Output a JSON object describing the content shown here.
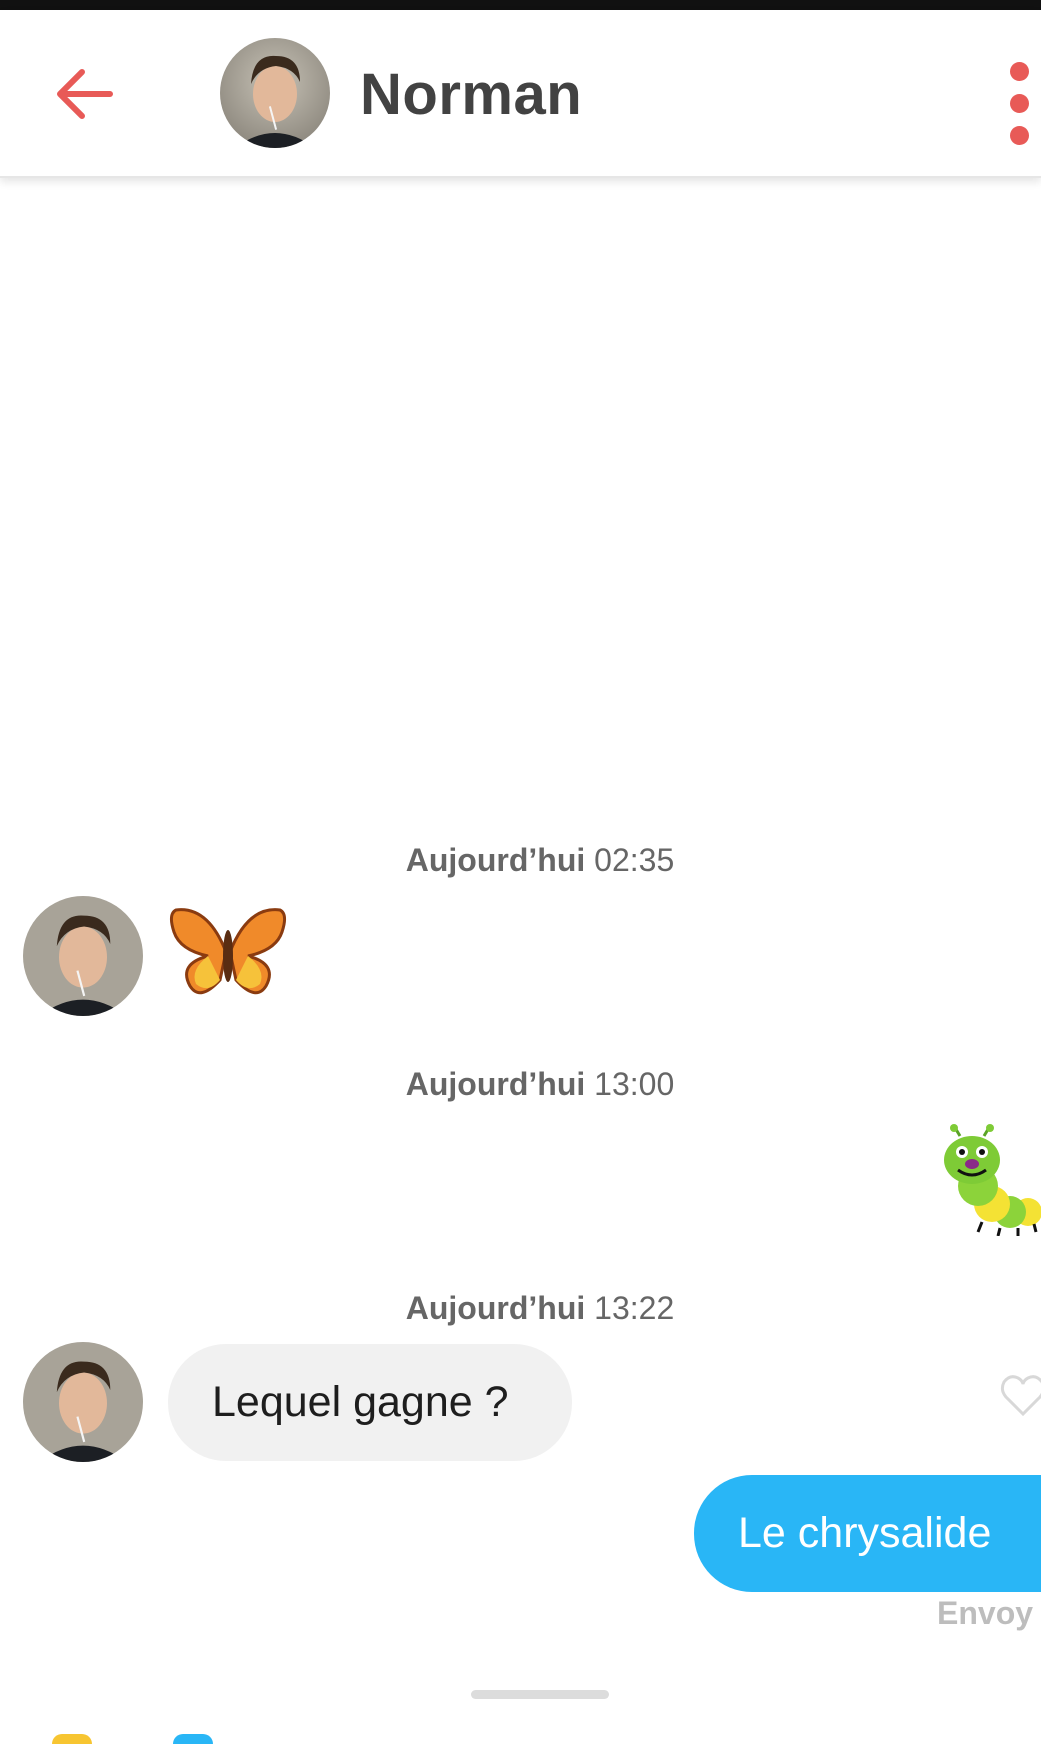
{
  "header": {
    "contact_name": "Norman",
    "back_icon": "arrow-left-icon",
    "more_icon": "more-vertical-icon",
    "accent_color": "#e85a57"
  },
  "messages": [
    {
      "timestamp_day": "Aujourd’hui",
      "timestamp_time": "02:35",
      "from": "contact",
      "content": "butterfly-emoji"
    },
    {
      "timestamp_day": "Aujourd’hui",
      "timestamp_time": "13:00",
      "from": "me",
      "content": "caterpillar-emoji"
    },
    {
      "timestamp_day": "Aujourd’hui",
      "timestamp_time": "13:22",
      "from": "contact",
      "text": "Lequel gagne ?"
    },
    {
      "from": "me",
      "text": "Le chrysalide",
      "status": "Envoy"
    }
  ],
  "colors": {
    "incoming_bubble": "#f1f1f1",
    "outgoing_bubble": "#29b6f6"
  }
}
